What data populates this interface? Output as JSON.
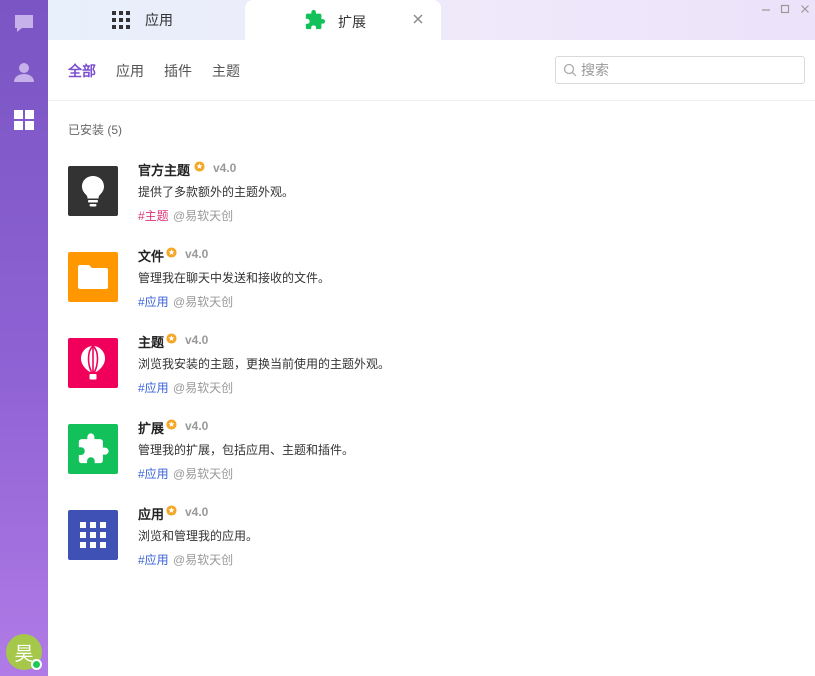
{
  "sidebar": {
    "items": [
      {
        "icon": "chat-icon"
      },
      {
        "icon": "contacts-icon"
      },
      {
        "icon": "apps-grid-icon"
      }
    ],
    "avatar": {
      "text": "昊",
      "color": "#a5c84a",
      "status_color": "#1fc85b"
    }
  },
  "tabs": [
    {
      "label": "应用",
      "icon": "apps-grid-icon"
    },
    {
      "label": "扩展",
      "icon": "puzzle-icon",
      "active": true
    }
  ],
  "filters": {
    "all": "全部",
    "apps": "应用",
    "plugins": "插件",
    "themes": "主题",
    "active": "全部"
  },
  "search": {
    "placeholder": "搜索",
    "value": ""
  },
  "installed": {
    "title": "已安装 (5)",
    "items": [
      {
        "name": "官方主题",
        "version": "v4.0",
        "description": "提供了多款额外的主题外观。",
        "tag": "#主题",
        "tag_color": "#e0327a",
        "author": "@易软天创",
        "icon": "lightbulb-icon",
        "color": "#333333"
      },
      {
        "name": "文件",
        "version": "v4.0",
        "description": "管理我在聊天中发送和接收的文件。",
        "tag": "#应用",
        "tag_color": "#3b63d8",
        "author": "@易软天创",
        "icon": "folder-icon",
        "color": "#ff9800"
      },
      {
        "name": "主题",
        "version": "v4.0",
        "description": "浏览我安装的主题，更换当前使用的主题外观。",
        "tag": "#应用",
        "tag_color": "#3b63d8",
        "author": "@易软天创",
        "icon": "balloon-icon",
        "color": "#f0005a"
      },
      {
        "name": "扩展",
        "version": "v4.0",
        "description": "管理我的扩展，包括应用、主题和插件。",
        "tag": "#应用",
        "tag_color": "#3b63d8",
        "author": "@易软天创",
        "icon": "puzzle-icon",
        "color": "#13c15b"
      },
      {
        "name": "应用",
        "version": "v4.0",
        "description": "浏览和管理我的应用。",
        "tag": "#应用",
        "tag_color": "#3b63d8",
        "author": "@易软天创",
        "icon": "apps-grid-icon",
        "color": "#3f51b5"
      }
    ]
  },
  "colors": {
    "accent": "#7b4fd0",
    "verified_badge": "#f5a623"
  }
}
